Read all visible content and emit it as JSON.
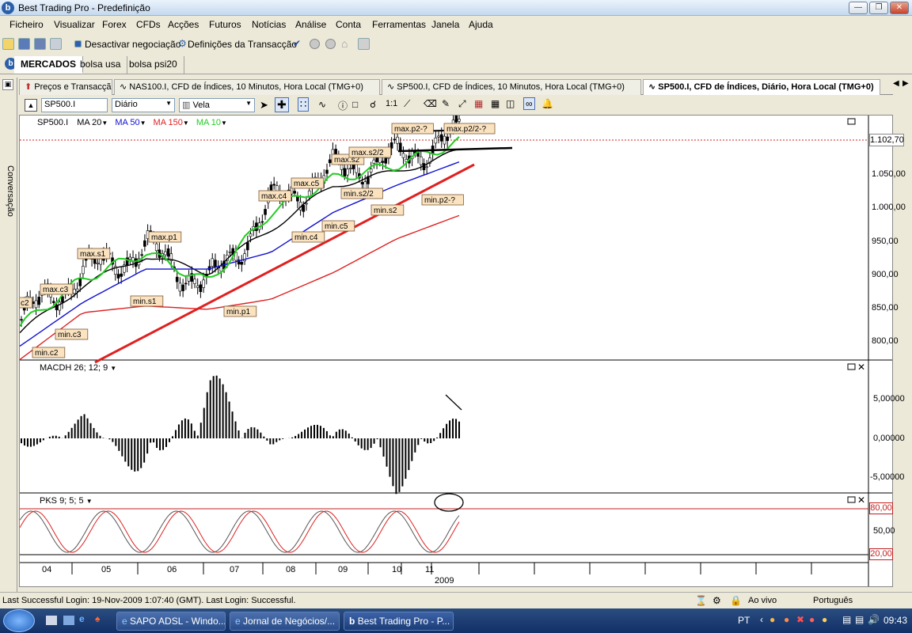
{
  "window": {
    "title": "Best Trading Pro - Predefinição",
    "logo": "b"
  },
  "menu": [
    "Ficheiro",
    "Visualizar",
    "Forex",
    "CFDs",
    "Acções",
    "Futuros",
    "Notícias",
    "Análise",
    "Conta",
    "Ferramentas",
    "Janela",
    "Ajuda"
  ],
  "toolbar": {
    "deactivate": "Desactivar negociação",
    "trade_settings": "Definições da Transacção"
  },
  "workspace_tabs": [
    "MERCADOS",
    "bolsa usa",
    "bolsa psi20"
  ],
  "side_panel": {
    "label": "Conversação"
  },
  "doc_tabs": [
    "Preços e Transacção",
    "NAS100.I, CFD de Índices, 10 Minutos, Hora Local (TMG+0)",
    "SP500.I, CFD de Índices, 10 Minutos, Hora Local (TMG+0)",
    "SP500.I, CFD de Índices, Diário, Hora Local (TMG+0)"
  ],
  "chart_toolbar": {
    "symbol": "SP500.I",
    "period": "Diário",
    "style": "Vela"
  },
  "legend": {
    "symbol": "SP500.I",
    "ma20": "MA 20",
    "ma50": "MA 50",
    "ma150": "MA 150",
    "ma10": "MA 10"
  },
  "colors": {
    "ma20": "#000000",
    "ma50": "#1010d0",
    "ma150": "#e02020",
    "ma10": "#22cc22",
    "trend": "#e02020",
    "macd": "#000000"
  },
  "price_axis": {
    "labels": [
      "1.050,00",
      "1.000,00",
      "950,00",
      "900,00",
      "850,00",
      "800,00"
    ],
    "current": "1.102,70"
  },
  "annotations": [
    "c2",
    "max.c3",
    "min.c2",
    "min.c3",
    "max.s1",
    "min.s1",
    "max.p1",
    "min.p1",
    "max.c4",
    "min.c4",
    "max.c5",
    "min.c5",
    "max.s2",
    "min.s2/2",
    "max.s2/2",
    "min.s2",
    "max.p2-?",
    "min.p2-?",
    "max.p2/2-?"
  ],
  "macd": {
    "label": "MACDH 26; 12; 9",
    "ticks": [
      "5,00000",
      "0,00000",
      "-5,00000"
    ]
  },
  "pks": {
    "label": "PKS 9; 5; 5",
    "ticks": [
      "80,00",
      "50,00",
      "20,00"
    ]
  },
  "x_axis": {
    "months": [
      "04",
      "05",
      "06",
      "07",
      "08",
      "09",
      "10",
      "11"
    ],
    "year": "2009"
  },
  "chart_data": {
    "type": "line",
    "title": "SP500.I",
    "x": [
      "04",
      "05",
      "06",
      "07",
      "08",
      "09",
      "10",
      "11"
    ],
    "series": [
      {
        "name": "SP500.I",
        "values": [
          830,
          900,
          935,
          880,
          1000,
          1050,
          1070,
          1102.7
        ]
      },
      {
        "name": "MA 20",
        "values": [
          810,
          880,
          925,
          900,
          965,
          1030,
          1050,
          1080
        ]
      },
      {
        "name": "MA 50",
        "values": [
          790,
          855,
          905,
          905,
          930,
          990,
          1030,
          1065
        ]
      },
      {
        "name": "MA 150",
        "values": [
          770,
          840,
          850,
          845,
          860,
          900,
          950,
          985
        ]
      },
      {
        "name": "MA 10",
        "values": [
          820,
          890,
          930,
          885,
          990,
          1040,
          1060,
          1095
        ]
      }
    ],
    "ylim": [
      780,
      1120
    ],
    "macd_values": [
      -2,
      3,
      -6,
      9,
      -1,
      3,
      -7,
      4
    ]
  },
  "status": {
    "login": "Last Successful Login: 19-Nov-2009 1:07:40 (GMT). Last Login: Successful.",
    "live": "Ao vivo",
    "language": "Português"
  },
  "taskbar": {
    "items": [
      "SAPO ADSL - Windo...",
      "Jornal de Negócios/...",
      "Best Trading Pro - P..."
    ],
    "lang": "PT",
    "time": "09:43"
  }
}
